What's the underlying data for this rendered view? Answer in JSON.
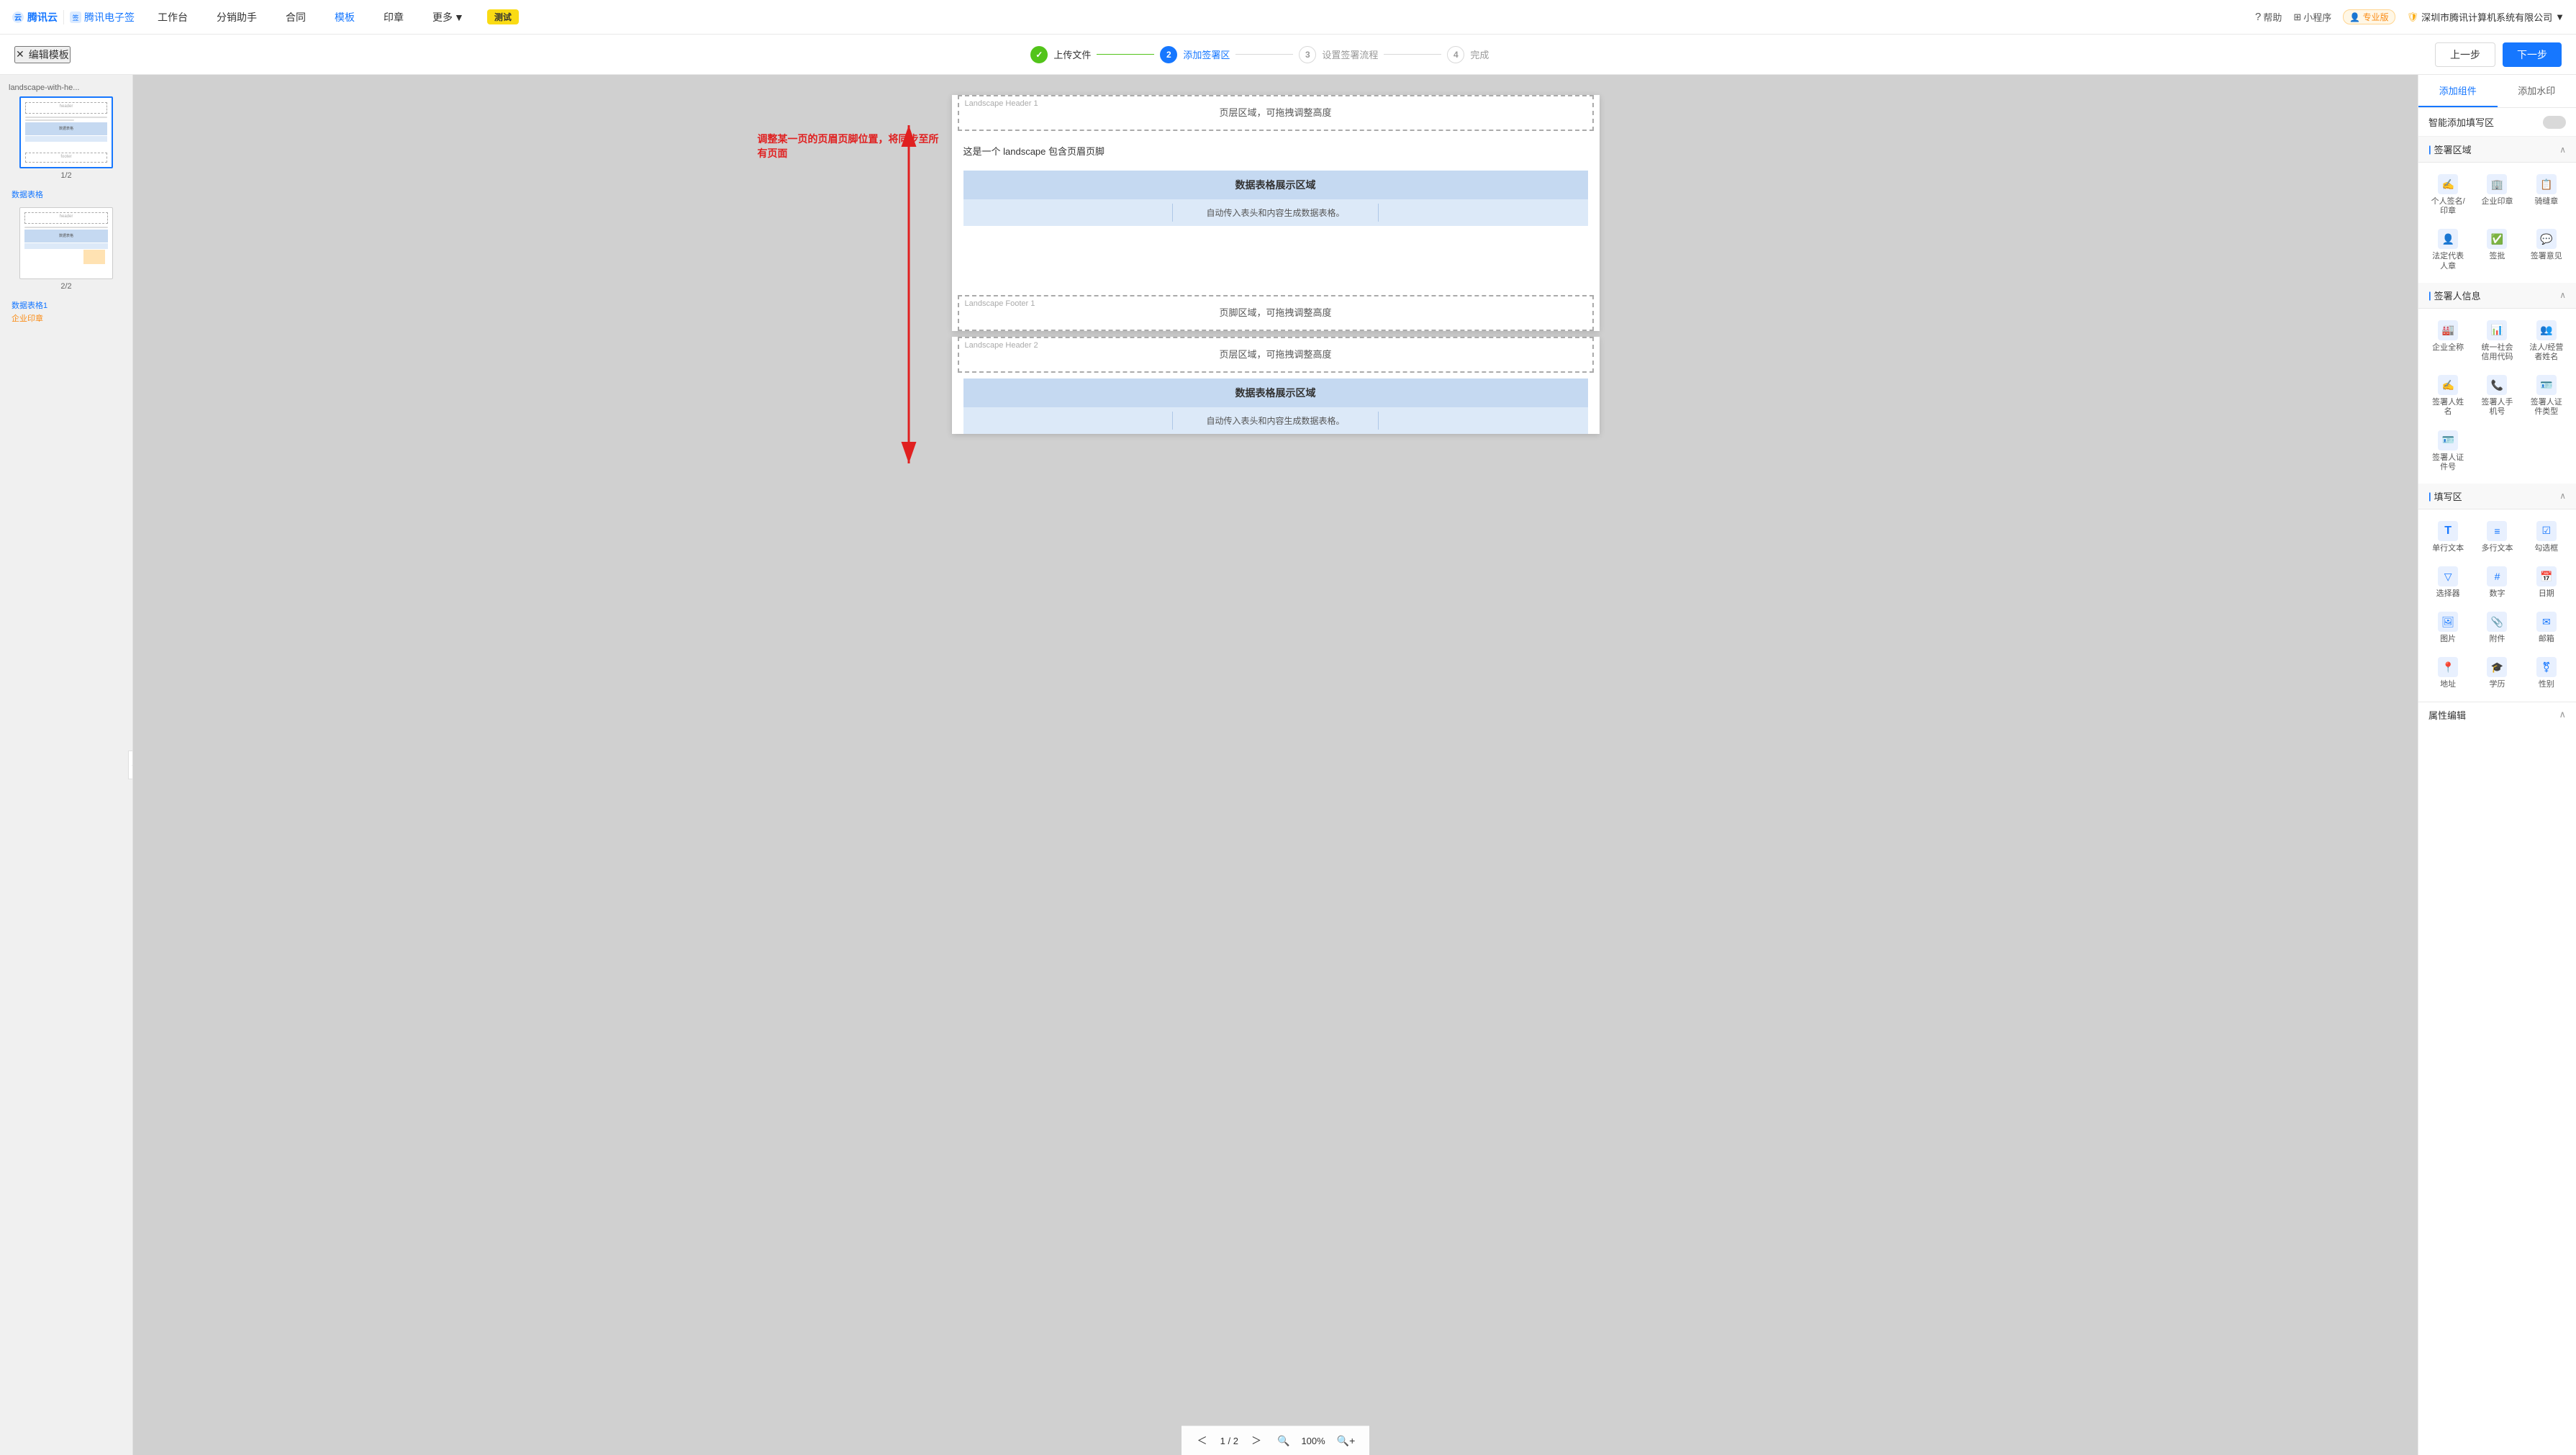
{
  "nav": {
    "logo_tencent": "腾讯云",
    "logo_esign": "腾讯电子签",
    "items": [
      "工作台",
      "分销助手",
      "合同",
      "模板",
      "印章",
      "更多"
    ],
    "more_icon": "▼",
    "test_label": "测试",
    "help": "帮助",
    "mini_program": "小程序",
    "pro": "专业版",
    "company": "深圳市腾讯计算机系统有限公司",
    "company_icon": "▼"
  },
  "subheader": {
    "back_icon": "✕",
    "title": "编辑模板",
    "steps": [
      {
        "num": "✓",
        "label": "上传文件",
        "state": "done"
      },
      {
        "num": "2",
        "label": "添加签署区",
        "state": "active"
      },
      {
        "num": "3",
        "label": "设置签署流程",
        "state": "inactive"
      },
      {
        "num": "4",
        "label": "完成",
        "state": "inactive"
      }
    ],
    "btn_prev": "上一步",
    "btn_next": "下一步"
  },
  "pages_sidebar": {
    "filename": "landscape-with-he...",
    "pages": [
      {
        "num": "1/2",
        "meta1": "数据表格",
        "meta1_color": "blue"
      },
      {
        "num": "2/2",
        "meta1": "数据表格1",
        "meta1_color": "blue",
        "meta2": "企业印章",
        "meta2_color": "orange"
      }
    ]
  },
  "canvas": {
    "page1": {
      "header_label": "Landscape Header 1",
      "header_text": "页层区域，可拖拽调整高度",
      "content_text": "这是一个 landscape 包含页眉页脚",
      "table_header": "数据表格展示区域",
      "table_sub": "自动传入表头和内容生成数据表格。",
      "footer_label": "Landscape Footer 1",
      "footer_text": "页脚区域，可拖拽调整高度"
    },
    "page2": {
      "header_label": "Landscape Header 2",
      "header_text": "页层区域，可拖拽调整高度",
      "table_sub": "自动传入表头和内容生成数据表格。"
    },
    "annotation": "调整某一页的页眉页脚位置，将同步至所有页面",
    "pagination": {
      "current": "1",
      "total": "2",
      "separator": "/",
      "zoom": "100%"
    }
  },
  "right_panel": {
    "tab_add_component": "添加组件",
    "tab_add_watermark": "添加水印",
    "auto_fill_label": "智能添加填写区",
    "sections": {
      "sign_area": {
        "title": "签署区域",
        "items": [
          {
            "label": "个人签名/印章",
            "icon": "✍"
          },
          {
            "label": "企业印章",
            "icon": "🏢"
          },
          {
            "label": "骑缝章",
            "icon": "📋"
          },
          {
            "label": "法定代表人章",
            "icon": "👤"
          },
          {
            "label": "签批",
            "icon": "✅"
          },
          {
            "label": "签署意见",
            "icon": "💬"
          }
        ]
      },
      "signer_info": {
        "title": "签署人信息",
        "items": [
          {
            "label": "企业全称",
            "icon": "🏭"
          },
          {
            "label": "统一社会信用代码",
            "icon": "📊"
          },
          {
            "label": "法人/经营者姓名",
            "icon": "👥"
          },
          {
            "label": "签署人姓名",
            "icon": "✍"
          },
          {
            "label": "签署人手机号",
            "icon": "📞"
          },
          {
            "label": "签署人证件类型",
            "icon": "🪪"
          },
          {
            "label": "签署人证件号",
            "icon": "🪪"
          }
        ]
      },
      "fill_area": {
        "title": "填写区",
        "items": [
          {
            "label": "单行文本",
            "icon": "T"
          },
          {
            "label": "多行文本",
            "icon": "≡"
          },
          {
            "label": "勾选框",
            "icon": "☑"
          },
          {
            "label": "选择器",
            "icon": "▽"
          },
          {
            "label": "数字",
            "icon": "#"
          },
          {
            "label": "日期",
            "icon": "📅"
          },
          {
            "label": "图片",
            "icon": "🖼"
          },
          {
            "label": "附件",
            "icon": "📎"
          },
          {
            "label": "邮箱",
            "icon": "✉"
          },
          {
            "label": "地址",
            "icon": "📍"
          },
          {
            "label": "学历",
            "icon": "🎓"
          },
          {
            "label": "性别",
            "icon": "⚧"
          }
        ]
      }
    },
    "attr_section": "属性编辑"
  }
}
